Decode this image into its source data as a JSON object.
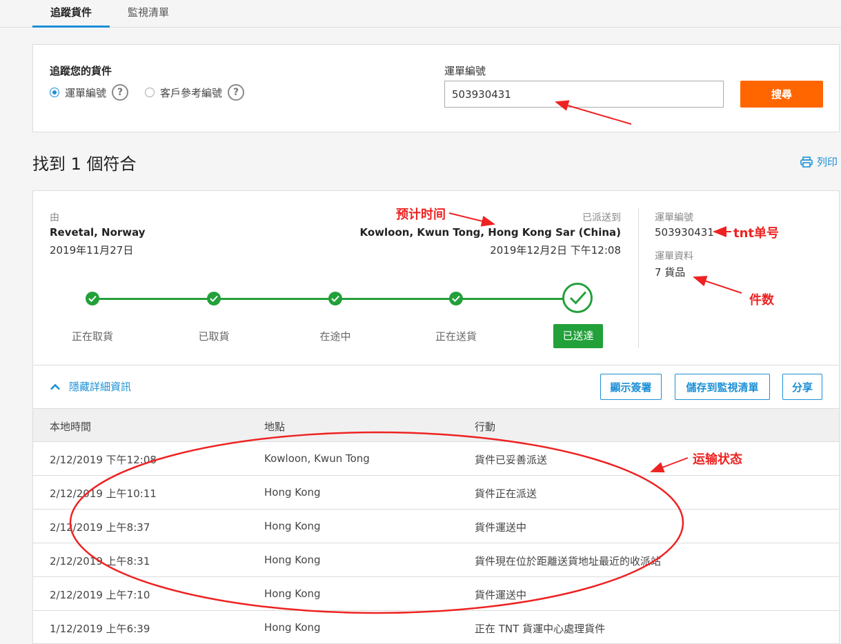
{
  "tabs": [
    "追蹤貨件",
    "監視清單"
  ],
  "search": {
    "title": "追蹤您的貨件",
    "radio_waybill": "運單編號",
    "radio_reference": "客戶參考編號",
    "help_glyph": "?",
    "field_label": "運單編號",
    "field_value": "503930431",
    "button": "搜尋"
  },
  "results": {
    "heading": "找到 1 個符合",
    "print": "列印"
  },
  "shipment": {
    "from_label": "由",
    "from_place": "Revetal, Norway",
    "from_date": "2019年11月27日",
    "to_label": "已派送到",
    "to_place": "Kowloon, Kwun Tong, Hong Kong Sar (China)",
    "to_date": "2019年12月2日 下午12:08",
    "waybill_label": "運單編號",
    "waybill_number": "503930431",
    "info_label": "運單資料",
    "info_value": "7 貨品"
  },
  "steps": [
    "正在取貨",
    "已取貨",
    "在途中",
    "正在送貨"
  ],
  "delivered_badge": "已送達",
  "details": {
    "toggle": "隱藏詳細資訊",
    "buttons": [
      "顯示簽署",
      "儲存到監視清單",
      "分享"
    ]
  },
  "table": {
    "headers": [
      "本地時間",
      "地點",
      "行動"
    ],
    "rows": [
      [
        "2/12/2019 下午12:08",
        "Kowloon, Kwun Tong",
        "貨件已妥善派送"
      ],
      [
        "2/12/2019 上午10:11",
        "Hong Kong",
        "貨件正在派送"
      ],
      [
        "2/12/2019 上午8:37",
        "Hong Kong",
        "貨件運送中"
      ],
      [
        "2/12/2019 上午8:31",
        "Hong Kong",
        "貨件現在位於距離送貨地址最近的收派站"
      ],
      [
        "2/12/2019 上午7:10",
        "Hong Kong",
        "貨件運送中"
      ],
      [
        "1/12/2019 上午6:39",
        "Hong Kong",
        "正在 TNT 貨運中心處理貨件"
      ]
    ]
  },
  "annotations": {
    "eta": "预计时间",
    "tnt": "tnt单号",
    "pieces": "件数",
    "status": "运输状态"
  },
  "colors": {
    "accent": "#1a8fd6",
    "search_button": "#ff6600",
    "success": "#22a03a",
    "annotation": "#ee2222"
  }
}
